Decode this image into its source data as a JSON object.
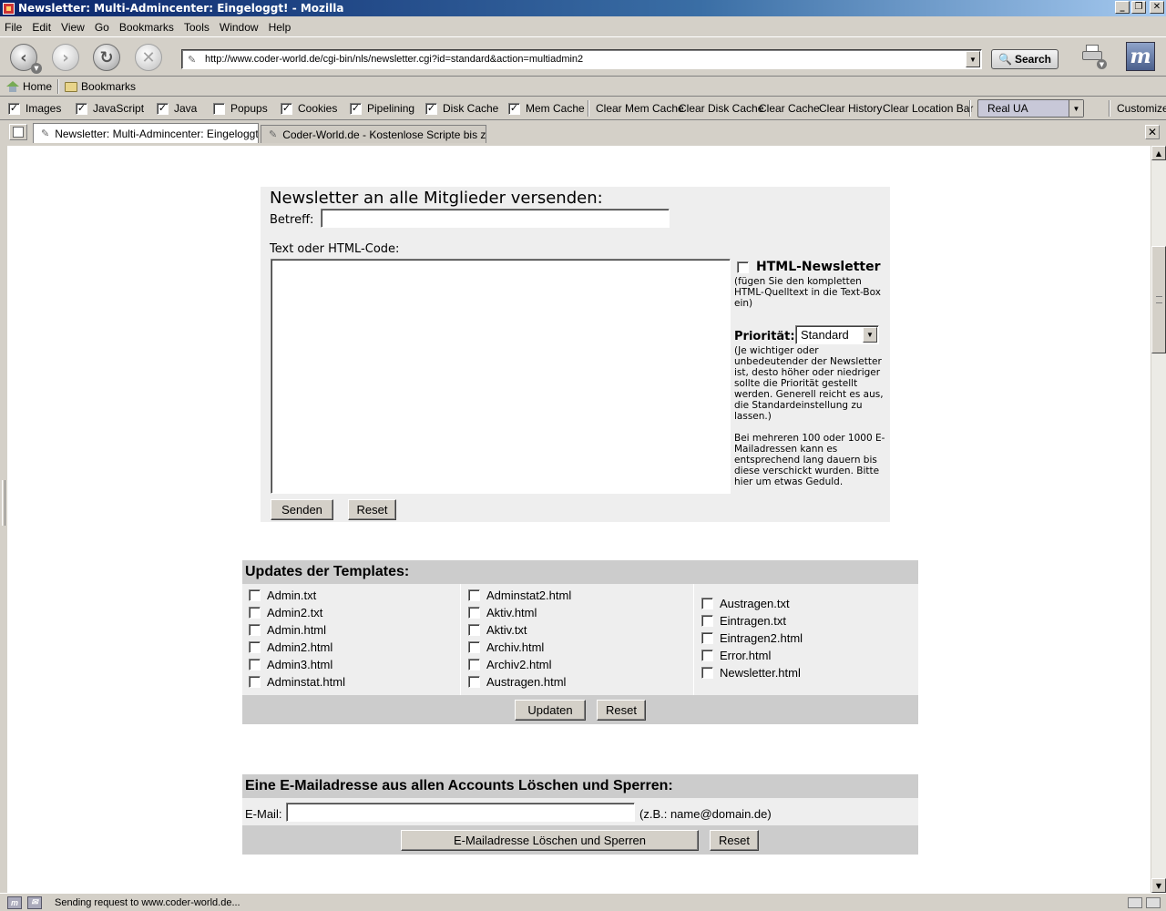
{
  "window": {
    "title": "Newsletter: Multi-Admincenter: Eingeloggt! - Mozilla"
  },
  "menu": [
    "File",
    "Edit",
    "View",
    "Go",
    "Bookmarks",
    "Tools",
    "Window",
    "Help"
  ],
  "nav": {
    "url": "http://www.coder-world.de/cgi-bin/nls/newsletter.cgi?id=standard&action=multiadmin2",
    "search_label": "Search"
  },
  "personal_toolbar": {
    "home": "Home",
    "bookmarks": "Bookmarks"
  },
  "prefbar": {
    "checks": [
      {
        "label": "Images",
        "checked": true
      },
      {
        "label": "JavaScript",
        "checked": true
      },
      {
        "label": "Java",
        "checked": true
      },
      {
        "label": "Popups",
        "checked": false
      },
      {
        "label": "Cookies",
        "checked": true
      },
      {
        "label": "Pipelining",
        "checked": true
      },
      {
        "label": "Disk Cache",
        "checked": true
      },
      {
        "label": "Mem Cache",
        "checked": true
      }
    ],
    "buttons": [
      "Clear Mem Cache",
      "Clear Disk Cache",
      "Clear Cache",
      "Clear History",
      "Clear Location Bar"
    ],
    "ua_value": "Real UA",
    "customize": "Customize"
  },
  "tabs": [
    {
      "label": "Newsletter: Multi-Admincenter: Eingeloggt!",
      "active": true
    },
    {
      "label": "Coder-World.de - Kostenlose Scripte bis zu...",
      "active": false
    }
  ],
  "newsletter": {
    "title": "Newsletter an alle Mitglieder versenden:",
    "subject_label": "Betreff:",
    "subject_value": "",
    "text_label": "Text oder HTML-Code:",
    "text_value": "",
    "html_checkbox_label": "HTML-Newsletter",
    "html_checked": false,
    "html_hint": "(fügen Sie den kompletten HTML-Quelltext in die Text-Box ein)",
    "priority_label": "Priorität:",
    "priority_value": "Standard",
    "priority_hint": "(Je wichtiger oder unbedeutender der Newsletter ist, desto höher oder niedriger sollte die Priorität gestellt werden. Generell reicht es aus, die Standardeinstellung zu lassen.)",
    "wait_hint": "Bei mehreren 100 oder 1000 E-Mailadressen kann es entsprechend lang dauern bis diese verschickt wurden. Bitte hier um etwas Geduld.",
    "send_label": "Senden",
    "reset_label": "Reset"
  },
  "templates": {
    "title": "Updates der Templates:",
    "col1": [
      "Admin.txt",
      "Admin2.txt",
      "Admin.html",
      "Admin2.html",
      "Admin3.html",
      "Adminstat.html"
    ],
    "col2": [
      "Adminstat2.html",
      "Aktiv.html",
      "Aktiv.txt",
      "Archiv.html",
      "Archiv2.html",
      "Austragen.html"
    ],
    "col3": [
      "Austragen.txt",
      "Eintragen.txt",
      "Eintragen2.html",
      "Error.html",
      "Newsletter.html"
    ],
    "update_label": "Updaten",
    "reset_label": "Reset"
  },
  "email_delete": {
    "title": "Eine E-Mailadresse aus allen Accounts Löschen und Sperren:",
    "email_label": "E-Mail:",
    "email_value": "",
    "hint": "(z.B.: name@domain.de)",
    "delete_label": "E-Mailadresse Löschen und Sperren",
    "reset_label": "Reset"
  },
  "status": {
    "text": "Sending request to www.coder-world.de..."
  }
}
